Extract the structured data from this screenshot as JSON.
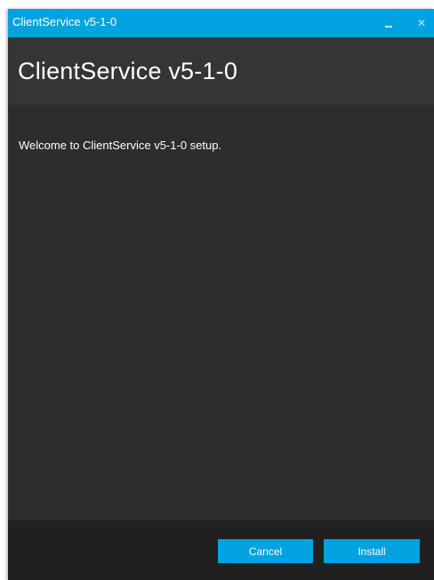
{
  "window": {
    "title": "ClientService v5-1-0",
    "minimize_icon": "minimize-icon",
    "close_icon": "close-icon",
    "close_glyph": "✕"
  },
  "header": {
    "heading": "ClientService v5-1-0"
  },
  "content": {
    "welcome_text": "Welcome to ClientService v5-1-0 setup."
  },
  "footer": {
    "cancel_label": "Cancel",
    "install_label": "Install"
  },
  "colors": {
    "accent": "#00a3e0",
    "background": "#2d2d2d",
    "header_background": "#353535",
    "footer_background": "#202020",
    "text": "#ffffff"
  }
}
